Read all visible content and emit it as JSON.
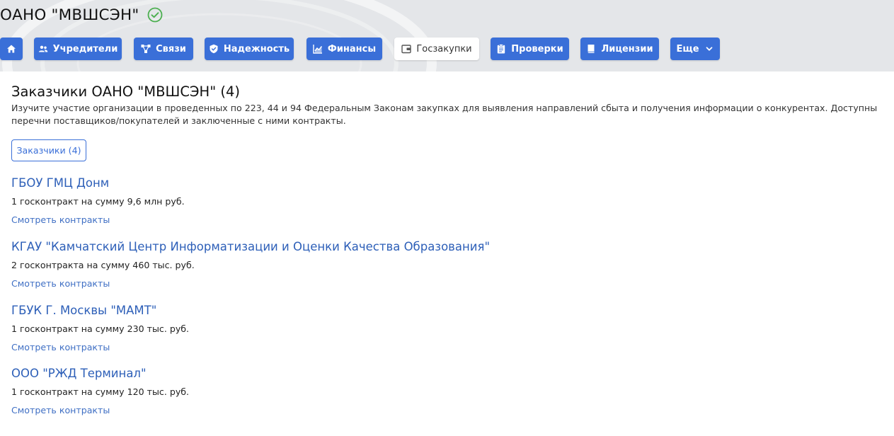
{
  "company": {
    "name": "ОАНО \"МВШСЭН\"",
    "verified_icon": "check-circle-icon",
    "verified_color": "#4caf50"
  },
  "nav": {
    "home_icon": "home-icon",
    "items": [
      {
        "label": "Учредители",
        "icon": "people-icon"
      },
      {
        "label": "Связи",
        "icon": "graph-icon"
      },
      {
        "label": "Надежность",
        "icon": "shield-icon"
      },
      {
        "label": "Финансы",
        "icon": "chart-icon"
      },
      {
        "label": "Госзакупки",
        "icon": "wallet-icon",
        "active": true
      },
      {
        "label": "Проверки",
        "icon": "clipboard-icon"
      },
      {
        "label": "Лицензии",
        "icon": "book-icon"
      },
      {
        "label": "Еще",
        "icon": "chevron-down-icon"
      }
    ]
  },
  "colors": {
    "accent": "#3a6fd8",
    "link": "#2d5fb8",
    "header_bg": "#e4e6e9"
  },
  "main": {
    "title": "Заказчики ОАНО \"МВШСЭН\" (4)",
    "description": "Изучите участие организации в проведенных по 223, 44 и 94 Федеральным Законам закупках для выявления направлений сбыта и получения информации о конкурентах. Доступны перечни поставщиков/покупателей и заключенные с ними контракты.",
    "filter_label": "Заказчики (4)",
    "customers": [
      {
        "name": "ГБОУ ГМЦ Донм",
        "summary": "1 госконтракт на сумму 9,6 млн руб.",
        "link": "Смотреть контракты"
      },
      {
        "name": "КГАУ \"Камчатский Центр Информатизации и Оценки Качества Образования\"",
        "summary": "2 госконтракта на сумму 460 тыс. руб.",
        "link": "Смотреть контракты"
      },
      {
        "name": "ГБУК Г. Москвы \"МАМТ\"",
        "summary": "1 госконтракт на сумму 230 тыс. руб.",
        "link": "Смотреть контракты"
      },
      {
        "name": "ООО \"РЖД Терминал\"",
        "summary": "1 госконтракт на сумму 120 тыс. руб.",
        "link": "Смотреть контракты"
      }
    ]
  }
}
